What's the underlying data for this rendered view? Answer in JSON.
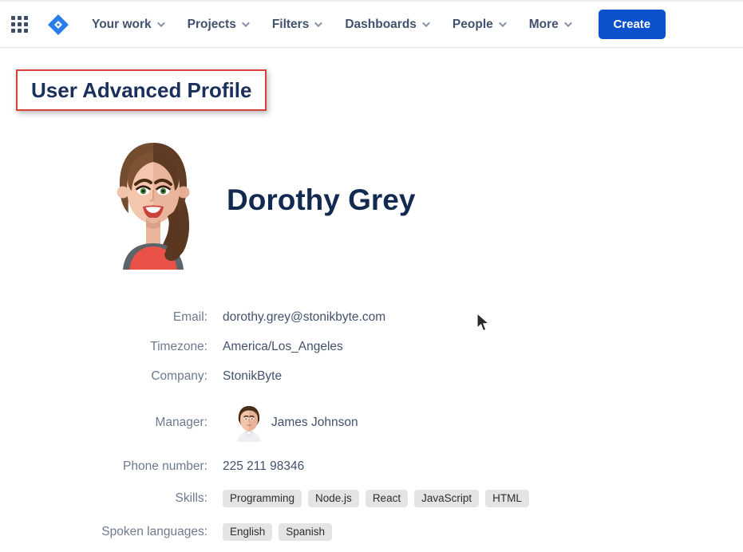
{
  "nav": {
    "items": [
      {
        "label": "Your work"
      },
      {
        "label": "Projects"
      },
      {
        "label": "Filters"
      },
      {
        "label": "Dashboards"
      },
      {
        "label": "People"
      },
      {
        "label": "More"
      }
    ],
    "create_label": "Create",
    "accent_color": "#0c52cc"
  },
  "page": {
    "title": "User Advanced Profile",
    "title_border_color": "#d6413c",
    "title_text_color": "#1b2f5d"
  },
  "profile": {
    "name": "Dorothy Grey",
    "fields": {
      "email": {
        "label": "Email:",
        "value": "dorothy.grey@stonikbyte.com"
      },
      "timezone": {
        "label": "Timezone:",
        "value": "America/Los_Angeles"
      },
      "company": {
        "label": "Company:",
        "value": "StonikByte"
      },
      "manager": {
        "label": "Manager:",
        "value": "James Johnson"
      },
      "phone": {
        "label": "Phone number:",
        "value": "225 211 98346"
      },
      "skills": {
        "label": "Skills:",
        "values": [
          "Programming",
          "Node.js",
          "React",
          "JavaScript",
          "HTML"
        ]
      },
      "languages": {
        "label": "Spoken languages:",
        "values": [
          "English",
          "Spanish"
        ]
      }
    },
    "badge_bg_color": "#e4e4e4"
  }
}
